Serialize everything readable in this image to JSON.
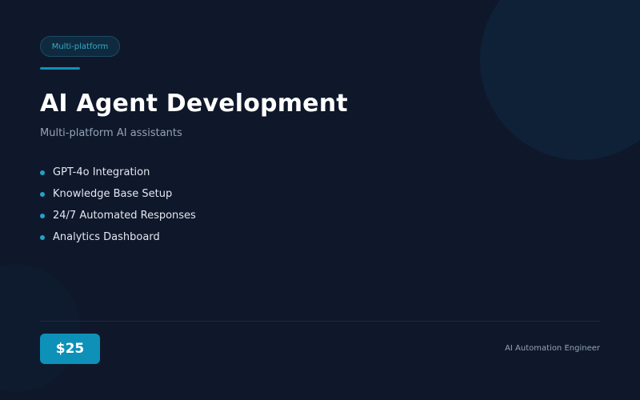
{
  "badge": {
    "label": "Multi-platform"
  },
  "title": "AI Agent Development",
  "subtitle": "Multi-platform AI assistants",
  "features": [
    "GPT-4o Integration",
    "Knowledge Base Setup",
    "24/7 Automated Responses",
    "Analytics Dashboard"
  ],
  "footer": {
    "price": "$25",
    "role": "AI Automation Engineer"
  },
  "colors": {
    "background": "#0f172a",
    "accent": "#0e91b8",
    "bullet": "#22a3c9",
    "muted_text": "#94a3b8"
  }
}
